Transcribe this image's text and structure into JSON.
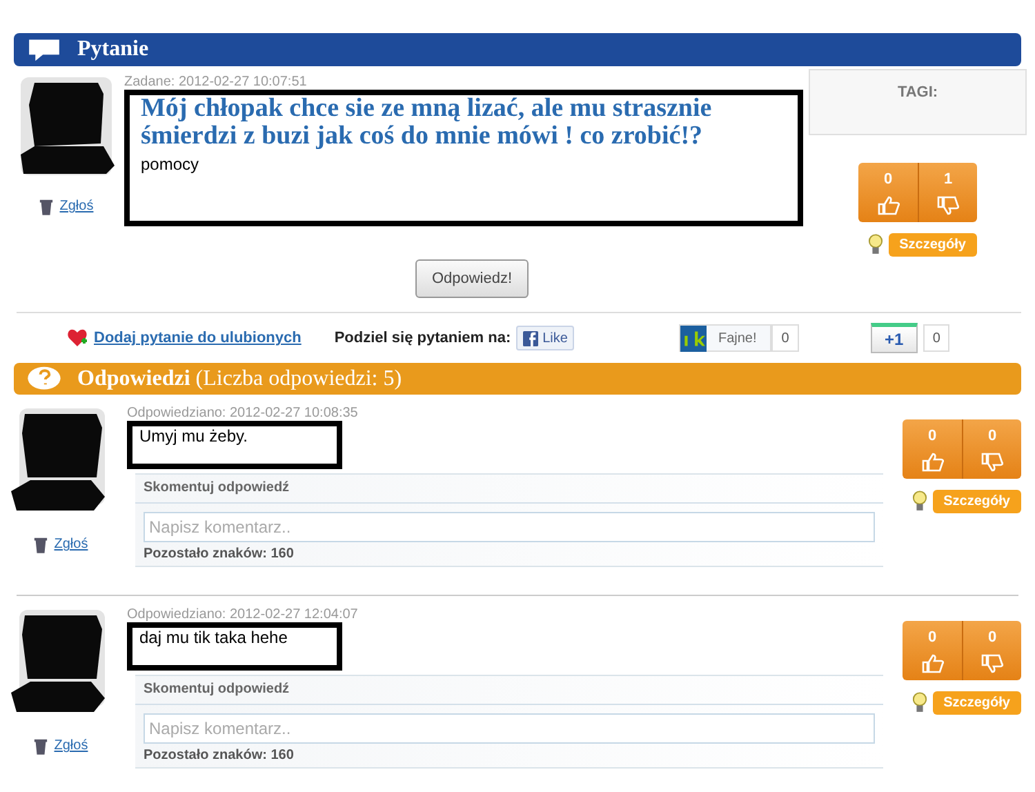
{
  "question_header": {
    "title": "Pytanie"
  },
  "question": {
    "date": "Zadane: 2012-02-27 10:07:51",
    "title": "Mój chłopak chce sie ze mną lizać, ale mu strasznie śmierdzi z buzi jak coś do mnie mówi ! co zrobić!?",
    "body": "pomocy",
    "report": "Zgłoś",
    "tags_label": "TAGI:",
    "votes_up": "0",
    "votes_down": "1",
    "details": "Szczegóły"
  },
  "answer_button": "Odpowiedz!",
  "share_bar": {
    "favorite": "Dodaj pytanie do ulubionych",
    "share_label": "Podziel się pytaniem na:",
    "fb_like": "Like",
    "nk_like": "Fajne!",
    "nk_count": "0",
    "gplus": "+1",
    "gplus_count": "0"
  },
  "answers_header": {
    "title": "Odpowiedzi",
    "count": "(Liczba odpowiedzi: 5)"
  },
  "answers": [
    {
      "date": "Odpowiedziano: 2012-02-27 10:08:35",
      "text": "Umyj mu żeby.",
      "votes_up": "0",
      "votes_down": "0",
      "details": "Szczegóły",
      "comment_heading": "Skomentuj odpowiedź",
      "comment_placeholder": "Napisz komentarz..",
      "remaining": "Pozostało znaków: 160",
      "report": "Zgłoś"
    },
    {
      "date": "Odpowiedziano: 2012-02-27 12:04:07",
      "text": "daj mu tik taka hehe",
      "votes_up": "0",
      "votes_down": "0",
      "details": "Szczegóły",
      "comment_heading": "Skomentuj odpowiedź",
      "comment_placeholder": "Napisz komentarz..",
      "remaining": "Pozostało znaków: 160",
      "report": "Zgłoś"
    }
  ]
}
